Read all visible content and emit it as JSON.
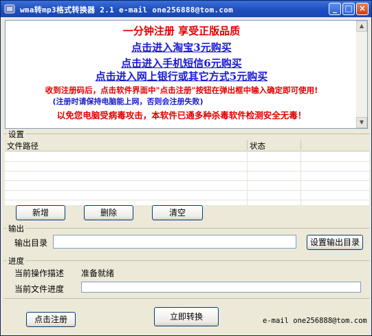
{
  "window": {
    "title": "wma转mp3格式转换器 2.1   e-mail one256888@tom.com"
  },
  "ad": {
    "line1": "一分钟注册 享受正版品质",
    "link_taobao": "点击进入淘宝3元购买",
    "link_sms": "点击进入手机短信6元购买",
    "link_bank": "点击进入网上银行或其它方式5元购买",
    "notice1": "收到注册码后，点击软件界面中\"点击注册\"按钮在弹出框中输入确定即可使用!",
    "notice2": "(注册时请保持电脑能上网，否则会注册失败)",
    "notice3": "以免您电脑受病毒攻击，本软件已通多种杀毒软件检测安全无毒！"
  },
  "settings": {
    "label": "设置",
    "columns": [
      "文件路径",
      "状态"
    ],
    "rows": [],
    "buttons": {
      "add": "新增",
      "delete": "删除",
      "clear": "清空"
    }
  },
  "output": {
    "label": "输出",
    "dir_label": "输出目录",
    "dir_value": "",
    "set_button": "设置输出目录"
  },
  "progress": {
    "label": "进度",
    "op_label": "当前操作描述",
    "op_value": "准备就绪",
    "file_label": "当前文件进度",
    "value_percent": 0
  },
  "footer": {
    "register_button": "点击注册",
    "convert_button": "立即转换",
    "email": "e-mail one256888@tom.com"
  }
}
